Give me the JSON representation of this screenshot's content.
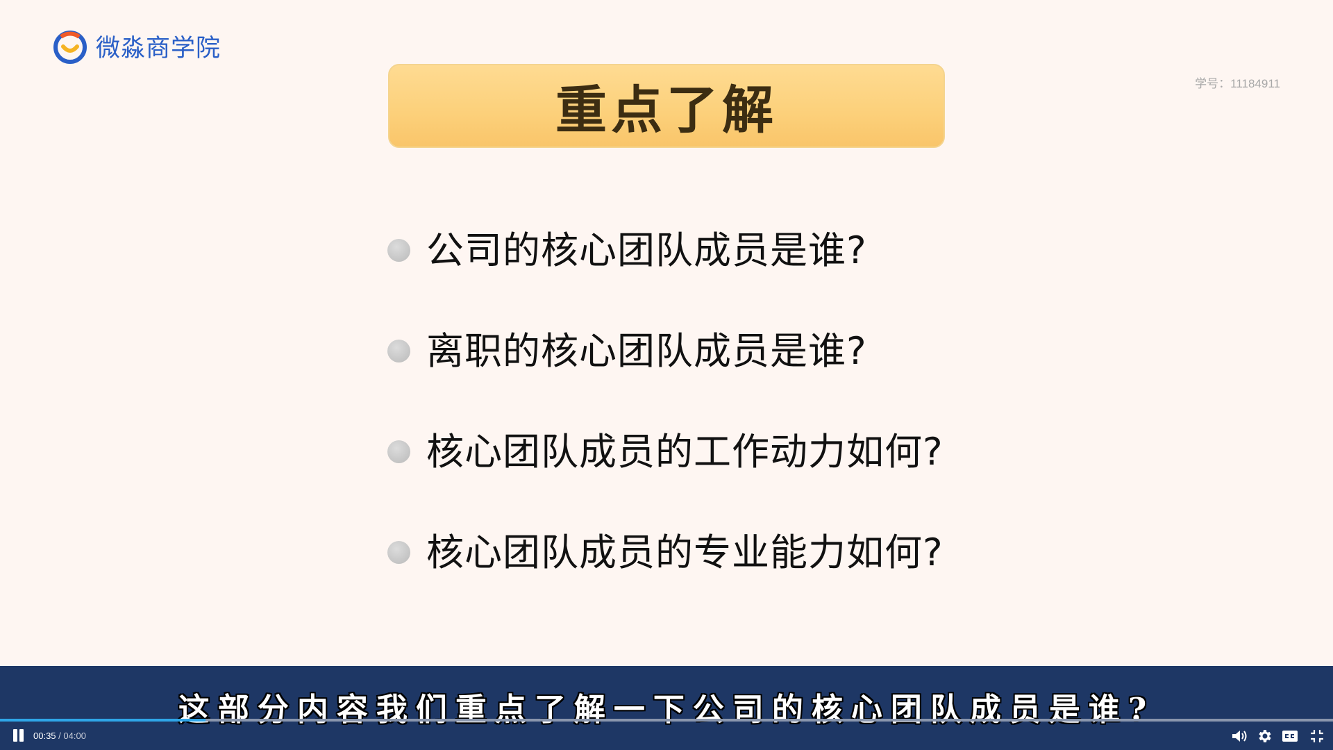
{
  "logo": {
    "text": "微淼商学院"
  },
  "student_id": {
    "label": "学号：",
    "value": "11184911"
  },
  "slide": {
    "title": "重点了解",
    "points": [
      "公司的核心团队成员是谁?",
      "离职的核心团队成员是谁?",
      "核心团队成员的工作动力如何?",
      "核心团队成员的专业能力如何?"
    ]
  },
  "player": {
    "subtitle": "这部分内容我们重点了解一下公司的核心团队成员是谁?",
    "current_time": "00:35",
    "separator": " / ",
    "total_time": "04:00",
    "progress_fraction": 0.154,
    "colors": {
      "bar_bg": "#1e3765",
      "progress": "#2fa6e8"
    }
  }
}
